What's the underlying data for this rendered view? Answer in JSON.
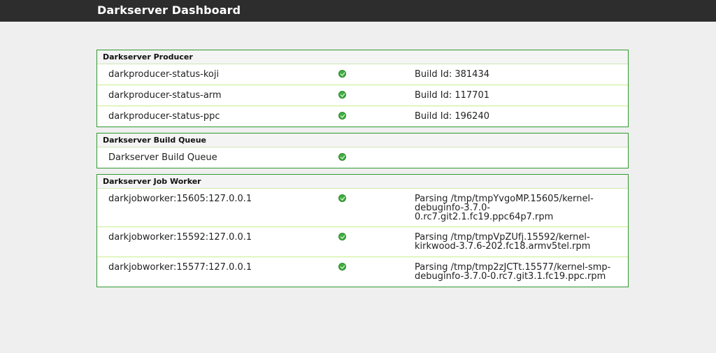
{
  "header": {
    "title": "Darkserver Dashboard"
  },
  "panels": [
    {
      "title": "Darkserver Producer",
      "rows": [
        {
          "name": "darkproducer-status-koji",
          "status": "ok",
          "info": "Build Id: 381434"
        },
        {
          "name": "darkproducer-status-arm",
          "status": "ok",
          "info": "Build Id: 117701"
        },
        {
          "name": "darkproducer-status-ppc",
          "status": "ok",
          "info": "Build Id: 196240"
        }
      ]
    },
    {
      "title": "Darkserver Build Queue",
      "rows": [
        {
          "name": "Darkserver Build Queue",
          "status": "ok",
          "info": ""
        }
      ]
    },
    {
      "title": "Darkserver Job Worker",
      "rows": [
        {
          "name": "darkjobworker:15605:127.0.0.1",
          "status": "ok",
          "info": "Parsing /tmp/tmpYvgoMP.15605/kernel-\ndebuginfo-3.7.0-0.rc7.git2.1.fc19.ppc64p7.rpm"
        },
        {
          "name": "darkjobworker:15592:127.0.0.1",
          "status": "ok",
          "info": "Parsing /tmp/tmpVpZUfj.15592/kernel-\nkirkwood-3.7.6-202.fc18.armv5tel.rpm"
        },
        {
          "name": "darkjobworker:15577:127.0.0.1",
          "status": "ok",
          "info": "Parsing /tmp/tmp2zJCTt.15577/kernel-smp-\ndebuginfo-3.7.0-0.rc7.git3.1.fc19.ppc.rpm"
        }
      ]
    }
  ],
  "icons": {
    "status_ok": "check-circle-icon"
  },
  "colors": {
    "accent_border": "#2f9a2f",
    "row_divider": "#c8ee8a",
    "ok_green": "#3fae3f",
    "topbar": "#2d2d2d"
  }
}
